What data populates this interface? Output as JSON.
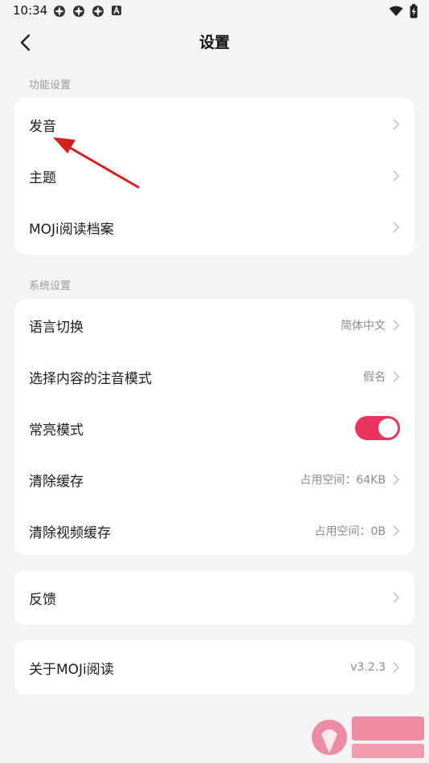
{
  "status_bar": {
    "time": "10:34"
  },
  "header": {
    "title": "设置"
  },
  "sections": {
    "function": {
      "label": "功能设置",
      "items": [
        {
          "label": "发音"
        },
        {
          "label": "主题"
        },
        {
          "label": "MOJi阅读档案"
        }
      ]
    },
    "system": {
      "label": "系统设置",
      "items": [
        {
          "label": "语言切换",
          "value": "简体中文"
        },
        {
          "label": "选择内容的注音模式",
          "value": "假名"
        },
        {
          "label": "常亮模式",
          "toggle_on": true
        },
        {
          "label": "清除缓存",
          "value": "占用空间：64KB"
        },
        {
          "label": "清除视频缓存",
          "value": "占用空间：0B"
        }
      ]
    }
  },
  "feedback": {
    "label": "反馈"
  },
  "about": {
    "label": "关于MOJi阅读",
    "value": "v3.2.3"
  },
  "colors": {
    "accent": "#e8345e",
    "annotation": "#d62020",
    "background": "#f4f4f6"
  }
}
